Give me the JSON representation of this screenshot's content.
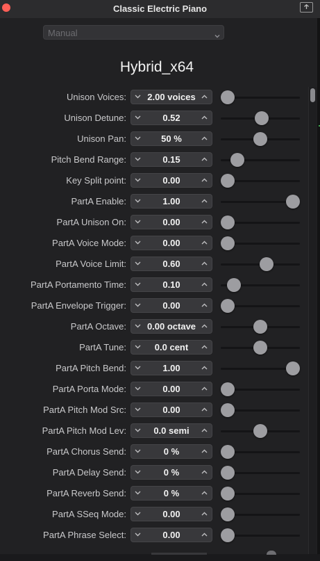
{
  "window": {
    "title": "Classic Electric Piano"
  },
  "preset": {
    "value": "Manual"
  },
  "plugin": {
    "name": "Hybrid_x64"
  },
  "params": [
    {
      "label": "Unison Voices:",
      "value": "2.00 voices",
      "slider": 0.0
    },
    {
      "label": "Unison Detune:",
      "value": "0.52",
      "slider": 0.52
    },
    {
      "label": "Unison Pan:",
      "value": "50 %",
      "slider": 0.5
    },
    {
      "label": "Pitch Bend Range:",
      "value": "0.15",
      "slider": 0.15
    },
    {
      "label": "Key Split point:",
      "value": "0.00",
      "slider": 0.0
    },
    {
      "label": "PartA Enable:",
      "value": "1.00",
      "slider": 1.0
    },
    {
      "label": "PartA Unison On:",
      "value": "0.00",
      "slider": 0.0
    },
    {
      "label": "PartA Voice Mode:",
      "value": "0.00",
      "slider": 0.0
    },
    {
      "label": "PartA Voice Limit:",
      "value": "0.60",
      "slider": 0.6
    },
    {
      "label": "PartA Portamento Time:",
      "value": "0.10",
      "slider": 0.1
    },
    {
      "label": "PartA Envelope Trigger:",
      "value": "0.00",
      "slider": 0.0
    },
    {
      "label": "PartA Octave:",
      "value": "0.00 octave",
      "slider": 0.5
    },
    {
      "label": "PartA Tune:",
      "value": "0.0 cent",
      "slider": 0.5
    },
    {
      "label": "PartA Pitch Bend:",
      "value": "1.00",
      "slider": 1.0
    },
    {
      "label": "PartA Porta Mode:",
      "value": "0.00",
      "slider": 0.0
    },
    {
      "label": "PartA Pitch Mod Src:",
      "value": "0.00",
      "slider": 0.0
    },
    {
      "label": "PartA Pitch Mod Lev:",
      "value": "0.0 semi",
      "slider": 0.5
    },
    {
      "label": "PartA Chorus Send:",
      "value": "0 %",
      "slider": 0.0
    },
    {
      "label": "PartA Delay Send:",
      "value": "0 %",
      "slider": 0.0
    },
    {
      "label": "PartA Reverb Send:",
      "value": "0 %",
      "slider": 0.0
    },
    {
      "label": "PartA SSeq Mode:",
      "value": "0.00",
      "slider": 0.0
    },
    {
      "label": "PartA Phrase Select:",
      "value": "0.00",
      "slider": 0.0
    }
  ],
  "icons": {
    "close": "close-icon",
    "share": "share-icon",
    "dropdown": "chevron-updown-icon",
    "decrement": "chevron-down-icon",
    "increment": "chevron-up-icon"
  },
  "colors": {
    "close": "#ff5f57",
    "knob": "#9d9da1",
    "background": "#212123"
  }
}
